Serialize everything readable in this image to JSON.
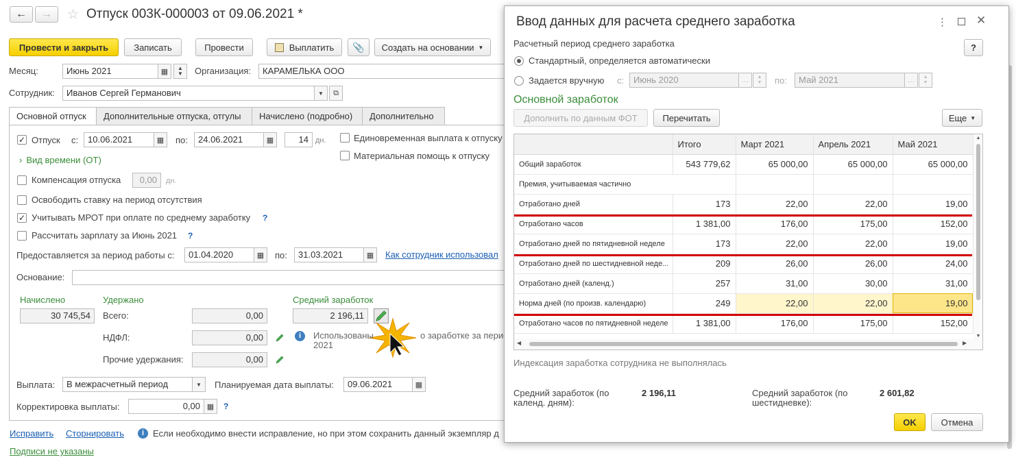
{
  "window": {
    "title": "Отпуск 003К-000003 от 09.06.2021 *"
  },
  "toolbar": {
    "post_close": "Провести и закрыть",
    "save": "Записать",
    "post": "Провести",
    "pay": "Выплатить",
    "create_based": "Создать на основании"
  },
  "form": {
    "month_label": "Месяц:",
    "month_value": "Июнь 2021",
    "org_label": "Организация:",
    "org_value": "КАРАМЕЛЬКА ООО",
    "employee_label": "Сотрудник:",
    "employee_value": "Иванов Сергей Германович",
    "tabs": [
      "Основной отпуск",
      "Дополнительные отпуска, отгулы",
      "Начислено (подробно)",
      "Дополнительно"
    ],
    "vacation_label": "Отпуск",
    "from_label": "с:",
    "from_value": "10.06.2021",
    "to_label": "по:",
    "to_value": "24.06.2021",
    "days_value": "14",
    "days_unit": "дн.",
    "lump_sum_label": "Единовременная выплата к отпуску",
    "material_help_label": "Материальная помощь к отпуску",
    "time_type_link": "Вид времени (ОТ)",
    "compensation_label": "Компенсация отпуска",
    "compensation_value": "0,00",
    "compensation_unit": "дн.",
    "release_rate_label": "Освободить ставку на период отсутствия",
    "mrot_label": "Учитывать МРОТ при оплате по среднему заработку",
    "calc_salary_label": "Рассчитать зарплату за Июнь 2021",
    "work_period_label": "Предоставляется за период работы с:",
    "work_from_value": "01.04.2020",
    "work_to_label": "по:",
    "work_to_value": "31.03.2021",
    "used_link": "Как сотрудник использовал",
    "basis_label": "Основание:",
    "accrued_header": "Начислено",
    "accrued_value": "30 745,54",
    "withheld_header": "Удержано",
    "total_label": "Всего:",
    "total_value": "0,00",
    "ndfl_label": "НДФЛ:",
    "ndfl_value": "0,00",
    "other_label": "Прочие удержания:",
    "other_value": "0,00",
    "avg_header": "Средний заработок",
    "avg_value": "2 196,11",
    "avg_info_1a": "Использованы",
    "avg_info_1b": "о заработке за период",
    "avg_info_2": "2021",
    "payment_label": "Выплата:",
    "payment_value": "В межрасчетный период",
    "planned_date_label": "Планируемая дата выплаты:",
    "planned_date_value": "09.06.2021",
    "correction_label": "Корректировка выплаты:",
    "correction_value": "0,00",
    "fix_link": "Исправить",
    "reverse_link": "Сторнировать",
    "fix_info": "Если необходимо внести исправление, но при этом сохранить данный экземпляр д",
    "signatures_link": "Подписи не указаны"
  },
  "dialog": {
    "title": "Ввод данных для расчета среднего заработка",
    "period_header": "Расчетный период среднего заработка",
    "help": "?",
    "standard_option": "Стандартный, определяется автоматически",
    "manual_option": "Задается вручную",
    "manual_from_label": "с:",
    "manual_from_value": "Июнь 2020",
    "manual_to_label": "по:",
    "manual_to_value": "Май 2021",
    "main_earnings_header": "Основной заработок",
    "fill_fot_button": "Дополнить по данным ФОТ",
    "recalc_button": "Перечитать",
    "more_button": "Еще",
    "columns": [
      "",
      "Итого",
      "Март 2021",
      "Апрель 2021",
      "Май 2021"
    ],
    "rows": [
      {
        "name": "Общий заработок",
        "total": "543 779,62",
        "m1": "65 000,00",
        "m2": "65 000,00",
        "m3": "65 000,00"
      },
      {
        "name": "Премия, учитываемая частично",
        "total": "",
        "m1": "",
        "m2": "",
        "m3": ""
      },
      {
        "name": "Отработано дней",
        "total": "173",
        "m1": "22,00",
        "m2": "22,00",
        "m3": "19,00"
      },
      {
        "name": "Отработано часов",
        "total": "1 381,00",
        "m1": "176,00",
        "m2": "175,00",
        "m3": "152,00"
      },
      {
        "name": "Отработано дней по пятидневной неделе",
        "total": "173",
        "m1": "22,00",
        "m2": "22,00",
        "m3": "19,00"
      },
      {
        "name": "Отработано дней по шестидневной неде...",
        "total": "209",
        "m1": "26,00",
        "m2": "26,00",
        "m3": "24,00"
      },
      {
        "name": "Отработано дней (календ.)",
        "total": "257",
        "m1": "31,00",
        "m2": "30,00",
        "m3": "31,00"
      },
      {
        "name": "Норма дней (по произв. календарю)",
        "total": "249",
        "m1": "22,00",
        "m2": "22,00",
        "m3": "19,00"
      },
      {
        "name": "Отработано часов по пятидневной неделе",
        "total": "1 381,00",
        "m1": "176,00",
        "m2": "175,00",
        "m3": "152,00"
      }
    ],
    "indexation_note": "Индексация заработка сотрудника не выполнялась",
    "avg_cal_label_1": "Средний заработок (по",
    "avg_cal_label_2": "календ. дням):",
    "avg_cal_value": "2 196,11",
    "avg_six_label_1": "Средний заработок (по",
    "avg_six_label_2": "шестидневке):",
    "avg_six_value": "2 601,82",
    "ok": "OK",
    "cancel": "Отмена"
  }
}
